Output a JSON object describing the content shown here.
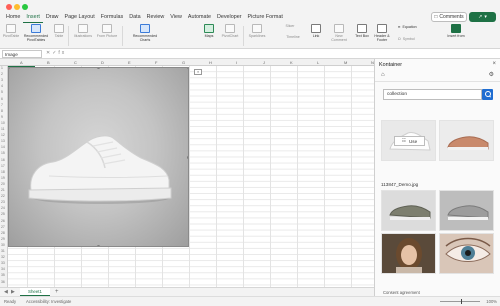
{
  "tabs": [
    "Home",
    "Insert",
    "Draw",
    "Page Layout",
    "Formulas",
    "Data",
    "Review",
    "View",
    "Automate",
    "Developer",
    "Picture Format"
  ],
  "active_tab": "Insert",
  "buttons": {
    "comments": "Comments",
    "share": ""
  },
  "ribbon": {
    "pivot_table": "PivotTable",
    "recommended_pivot": "Recommended PivotTables",
    "table": "Table",
    "illustrations": "Illustrations",
    "from_picture": "From Picture",
    "recommended_charts": "Recommended Charts",
    "maps": "Maps",
    "pivot_chart": "PivotChart",
    "sparklines": "Sparklines",
    "slicer": "Slicer",
    "timeline": "Timeline",
    "link": "Link",
    "new_comment": "New Comment",
    "text_box": "Text Box",
    "header_footer": "Header & Footer",
    "equation": "Equation",
    "symbol": "Symbol",
    "insert_from": "Insert from"
  },
  "formula_bar": {
    "name_box": "Image"
  },
  "columns": [
    "A",
    "B",
    "C",
    "D",
    "E",
    "F",
    "G",
    "H",
    "I",
    "J",
    "K",
    "L",
    "M",
    "N"
  ],
  "rows": [
    "1",
    "2",
    "3",
    "4",
    "5",
    "6",
    "7",
    "8",
    "9",
    "10",
    "11",
    "12",
    "13",
    "14",
    "15",
    "16",
    "17",
    "18",
    "19",
    "20",
    "21",
    "22",
    "23",
    "24",
    "25",
    "26",
    "27",
    "28",
    "29",
    "30",
    "31",
    "32",
    "33",
    "34",
    "35",
    "36"
  ],
  "sheet": {
    "name": "Sheet1"
  },
  "status": {
    "ready": "Ready",
    "accessibility": "Accessibility: Investigate",
    "zoom": "100%"
  },
  "panel": {
    "title": "Kontainer",
    "search_value": "collection",
    "use_label": "Use",
    "filename": "113847_Demo.jpg",
    "footer": "Consent agreement"
  },
  "colors": {
    "accent": "#1e7145",
    "search_button": "#1f6dd1"
  },
  "icons": [
    "search-icon",
    "gear-icon",
    "home-icon",
    "close-icon",
    "comment-icon",
    "share-icon",
    "plus-icon"
  ]
}
